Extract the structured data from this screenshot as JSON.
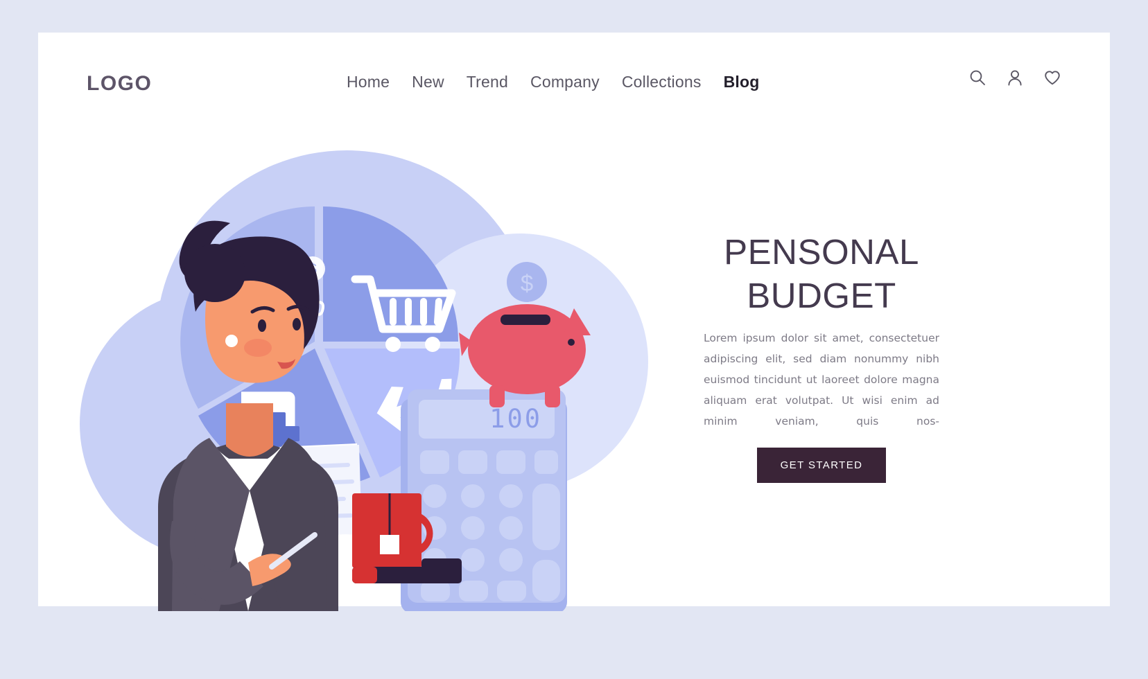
{
  "page": {
    "background_color": "#e2e6f3",
    "canvas_color": "#ffffff"
  },
  "header": {
    "logo": "LOGO",
    "nav": [
      {
        "label": "Home",
        "active": false
      },
      {
        "label": "New",
        "active": false
      },
      {
        "label": "Trend",
        "active": false
      },
      {
        "label": "Company",
        "active": false
      },
      {
        "label": "Collections",
        "active": false
      },
      {
        "label": "Blog",
        "active": true
      }
    ],
    "icons": [
      {
        "name": "search-icon",
        "glyph": "magnifier"
      },
      {
        "name": "account-icon",
        "glyph": "person"
      },
      {
        "name": "favorites-icon",
        "glyph": "heart"
      }
    ]
  },
  "hero": {
    "headline": "PENSONAL\nBUDGET",
    "headline_line_1": "PENSONAL",
    "headline_line_2": "BUDGET",
    "paragraph": "Lorem ipsum dolor sit amet, consectetuer adipiscing elit, sed diam nonummy nibh euismod tincidunt ut laoreet dolore magna aliquam erat volutpat. Ut wisi enim ad minim veniam, quis nos-",
    "cta_label": "GET STARTED",
    "headline_color": "#443a4e",
    "paragraph_color": "#7d7a86",
    "cta_bg_color": "#3a2437",
    "cta_text_color": "#ffffff"
  },
  "illustration": {
    "alt": "Businesswoman taking notes beside a budget pie chart, piggy bank and calculator",
    "pie_chart": {
      "title": "budget-pie-chart",
      "segments": [
        {
          "label": "savings",
          "icon": "piggy-bank-icon",
          "color": "#a9b6ef"
        },
        {
          "label": "shopping",
          "icon": "shopping-cart-icon",
          "color": "#8c9de8"
        },
        {
          "label": "health",
          "icon": "health-shield-icon",
          "color": "#8b9ce8"
        },
        {
          "label": "travel",
          "icon": "airplane-icon",
          "color": "#b3befb"
        }
      ]
    },
    "calculator": {
      "display_value": "100",
      "body_color": "#aebaf0",
      "screen_color": "#c3cdf5"
    },
    "piggy_bank": {
      "color": "#e8596b",
      "coin_label": "$"
    },
    "mug": {
      "color": "#d63232",
      "label": "tea-mug"
    },
    "notepad": {
      "color": "#e8596b",
      "label": "notepad"
    },
    "character": {
      "label": "businesswoman",
      "hair_color": "#2b1f3d",
      "jacket_color": "#4c4657",
      "skin_color": "#f79a6e",
      "shirt_color": "#ffffff"
    },
    "backdrop_color": "#c5cef5",
    "backdrop_color_light": "#dde3fb"
  }
}
